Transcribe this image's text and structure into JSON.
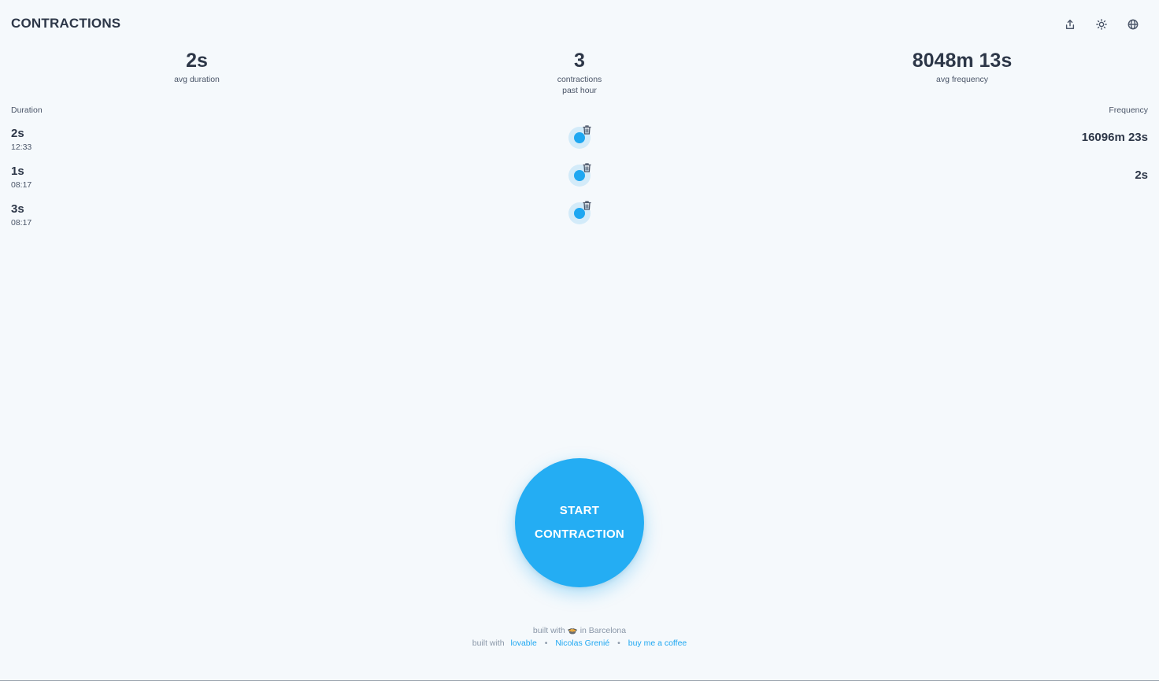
{
  "header": {
    "title": "CONTRACTIONS",
    "actions": [
      {
        "name": "share-icon"
      },
      {
        "name": "sun-icon"
      },
      {
        "name": "globe-icon"
      }
    ]
  },
  "stats": {
    "avg_duration": {
      "value": "2s",
      "label": "avg duration"
    },
    "count": {
      "value": "3",
      "label_line1": "contractions",
      "label_line2": "past hour"
    },
    "avg_frequency": {
      "value": "8048m 13s",
      "label": "avg frequency"
    }
  },
  "columns": {
    "duration": "Duration",
    "frequency": "Frequency"
  },
  "rows": [
    {
      "duration": "2s",
      "time": "12:33",
      "frequency": "16096m 23s"
    },
    {
      "duration": "1s",
      "time": "08:17",
      "frequency": "2s"
    },
    {
      "duration": "3s",
      "time": "08:17",
      "frequency": ""
    }
  ],
  "start_button": {
    "line1": "START",
    "line2": "CONTRACTION"
  },
  "footer": {
    "line1_prefix": "built with",
    "line1_emoji": "🍲",
    "line1_suffix": "in Barcelona",
    "line2_prefix": "built with",
    "links": [
      "lovable",
      "Nicolas Grenié",
      "buy me a coffee"
    ]
  },
  "colors": {
    "accent": "#24adf3",
    "background": "#f5f9fc",
    "text": "#2d3748"
  }
}
